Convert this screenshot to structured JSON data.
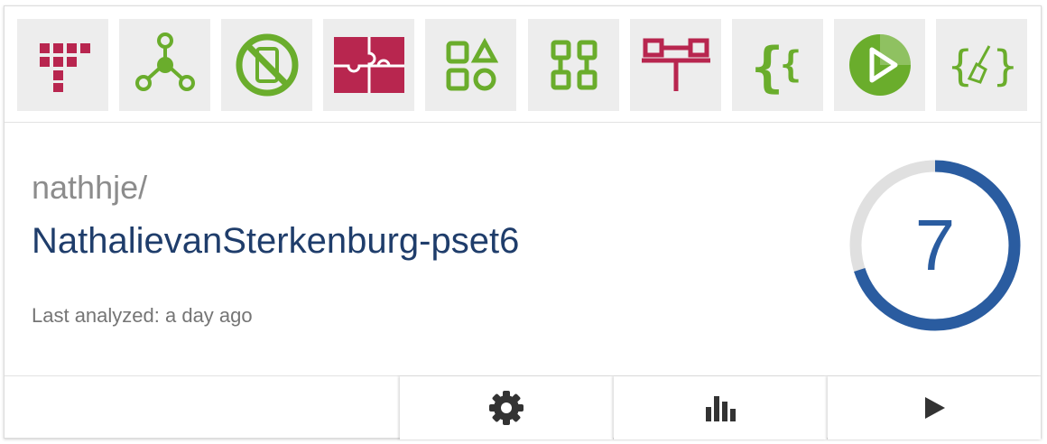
{
  "icons": [
    {
      "name": "triangle-dots-icon",
      "color": "#b8264f"
    },
    {
      "name": "network-graph-icon",
      "color": "#6aad2c"
    },
    {
      "name": "no-mobile-icon",
      "color": "#6aad2c"
    },
    {
      "name": "puzzle-icon",
      "color": "#b8264f"
    },
    {
      "name": "shapes-grid-icon",
      "color": "#6aad2c"
    },
    {
      "name": "modules-icon",
      "color": "#6aad2c"
    },
    {
      "name": "hierarchy-icon",
      "color": "#b8264f"
    },
    {
      "name": "curly-braces-icon",
      "color": "#6aad2c"
    },
    {
      "name": "play-circle-icon",
      "color": "#6aad2c"
    },
    {
      "name": "code-cleanup-icon",
      "color": "#6aad2c"
    }
  ],
  "repo": {
    "owner": "nathhje/",
    "name": "NathalievanSterkenburg-pset6",
    "last_analyzed": "Last analyzed: a day ago"
  },
  "score": {
    "value": "7",
    "fraction": 0.7,
    "color": "#2a5ca0",
    "track_color": "#e0e0e0"
  },
  "footer": {
    "buttons": [
      {
        "name": "settings-button",
        "icon": "gear-icon"
      },
      {
        "name": "stats-button",
        "icon": "bar-chart-icon"
      },
      {
        "name": "run-button",
        "icon": "play-icon"
      }
    ]
  }
}
